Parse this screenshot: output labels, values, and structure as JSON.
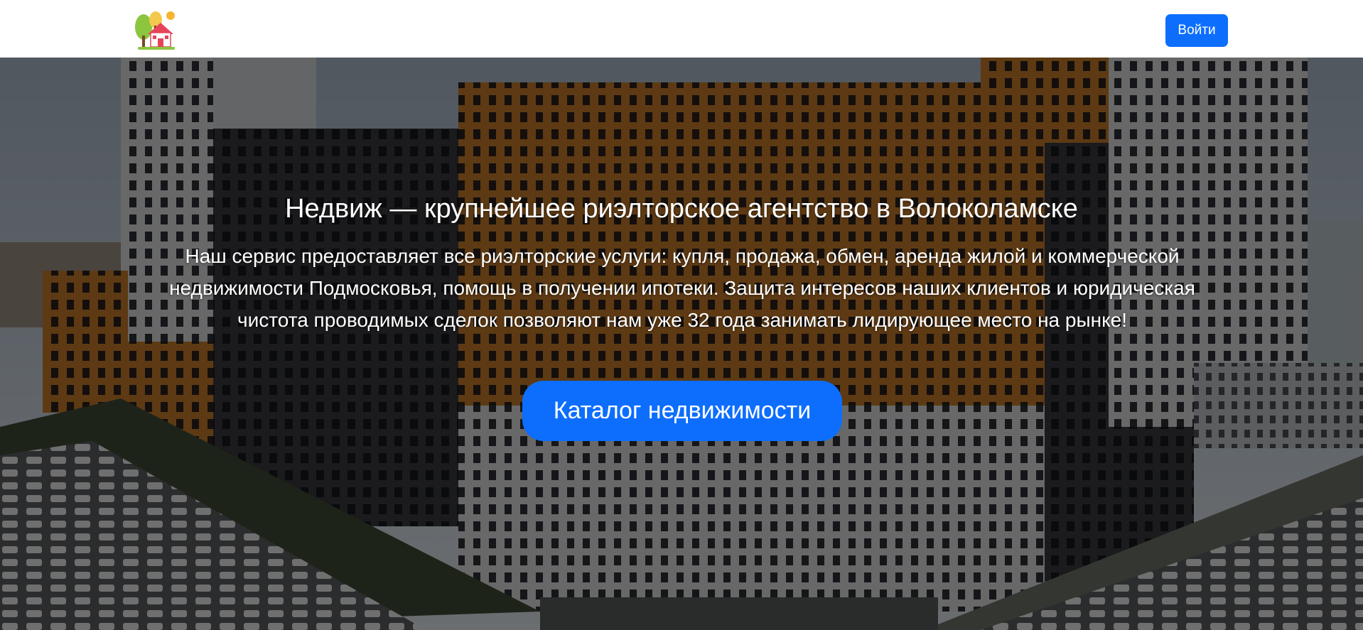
{
  "header": {
    "logo_icon": "house-with-trees-logo",
    "login_label": "Войти"
  },
  "hero": {
    "title": "Недвиж — крупнейшее риэлторское агентство в Волоколамске",
    "description": "Наш сервис предоставляет все риэлторские услуги: купля, продажа, обмен, аренда жилой и коммерческой недвижимости Подмосковья, помощь в получении ипотеки. Защита интересов наших клиентов и юридическая чистота проводимых сделок позволяют нам уже 32 года занимать лидирующее место на рынке!",
    "catalog_button_label": "Каталог недвижимости",
    "background_image": "residential-high-rise-buildings-photo"
  },
  "colors": {
    "accent": "#0d6efd",
    "header_bg": "#ffffff",
    "text_on_hero": "#ffffff"
  }
}
